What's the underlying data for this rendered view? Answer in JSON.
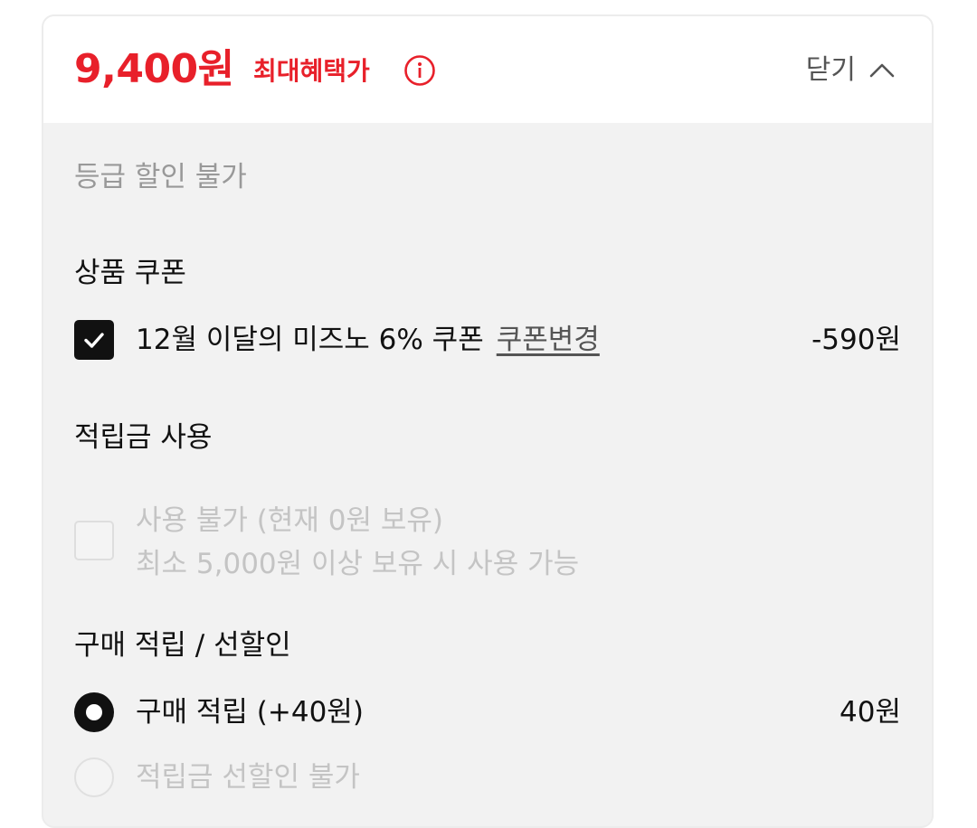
{
  "header": {
    "price": "9,400원",
    "benefit_label": "최대혜택가",
    "close_label": "닫기",
    "accent_color": "#e8202a"
  },
  "grade_discount": {
    "text": "등급 할인 불가"
  },
  "product_coupon": {
    "title": "상품 쿠폰",
    "coupon_label": "12월 이달의 미즈노 6% 쿠폰",
    "change_link": "쿠폰변경",
    "amount": "-590원",
    "checked": true
  },
  "points_use": {
    "title": "적립금 사용",
    "line1": "사용 불가 (현재 0원 보유)",
    "line2": "최소 5,000원 이상 보유 시 사용 가능",
    "checked": false,
    "disabled": true
  },
  "purchase_reward": {
    "title": "구매 적립 / 선할인",
    "options": [
      {
        "label": "구매 적립 (+40원)",
        "amount": "40원",
        "selected": true,
        "disabled": false
      },
      {
        "label": "적립금 선할인 불가",
        "amount": "",
        "selected": false,
        "disabled": true
      }
    ]
  },
  "icons": {
    "info": "info-circle-icon",
    "chevron": "chevron-up-icon",
    "check": "check-icon"
  }
}
